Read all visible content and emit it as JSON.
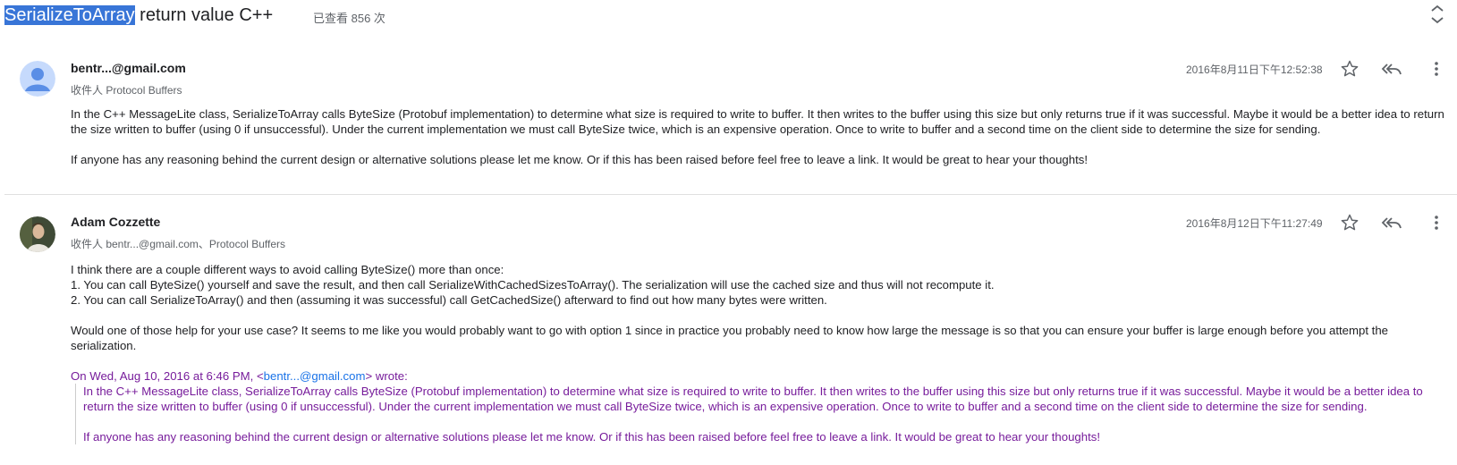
{
  "thread": {
    "subject_highlight": "SerializeToArray",
    "subject_rest": " return value C++",
    "views": "已查看 856 次"
  },
  "posts": [
    {
      "sender": "bentr...@gmail.com",
      "recipients": "收件人 Protocol Buffers",
      "date": "2016年8月11日下午12:52:38",
      "paragraphs": [
        "In the C++ MessageLite class, SerializeToArray calls ByteSize (Protobuf implementation) to determine what size is required to write to buffer. It then writes to the buffer using this size but only returns true if it was successful. Maybe it would be a better idea to return the size written to buffer (using 0 if unsuccessful). Under the current implementation we must call ByteSize twice, which is an expensive operation. Once to write to buffer and a second time on the client side to determine the size for sending.",
        "If anyone has any reasoning behind the current design or alternative solutions please let me know. Or if this has been raised before feel free to leave a link. It would be great to hear your thoughts!"
      ]
    },
    {
      "sender": "Adam Cozzette",
      "recipients": "收件人 bentr...@gmail.com、Protocol Buffers",
      "date": "2016年8月12日下午11:27:49",
      "lines": [
        "I think there are a couple different ways to avoid calling ByteSize() more than once:",
        "1. You can call ByteSize() yourself and save the result, and then call SerializeWithCachedSizesToArray(). The serialization will use the cached size and thus will not recompute it.",
        "2. You can call SerializeToArray() and then (assuming it was successful) call GetCachedSize() afterward to find out how many bytes were written."
      ],
      "paragraph2": "Would one of those help for your use case? It seems to me like you would probably want to go with option 1 since in practice you probably need to know how large the message is so that you can ensure your buffer is large enough before you attempt the serialization.",
      "quote_intro": "On Wed, Aug 10, 2016 at 6:46 PM, <",
      "quote_link": "bentr...@gmail.com",
      "quote_outro": "> wrote:",
      "quote_paragraphs": [
        "In the C++ MessageLite class, SerializeToArray calls ByteSize (Protobuf implementation) to determine what size is required to write to buffer. It then writes to the buffer using this size but only returns true if it was successful. Maybe it would be a better idea to return the size written to buffer (using 0 if unsuccessful). Under the current implementation we must call ByteSize twice, which is an expensive operation. Once to write to buffer and a second time on the client side to determine the size for sending.",
        "If anyone has any reasoning behind the current design or alternative solutions please let me know. Or if this has been raised before feel free to leave a link. It would be great to hear your thoughts!"
      ]
    }
  ],
  "icons": {
    "collapse": "collapse-chevrons-icon",
    "star": "star-icon",
    "reply_all": "reply-all-icon",
    "more": "more-vert-icon",
    "avatar_default": "default-person-avatar-icon"
  },
  "colors": {
    "selection": "#3875d7",
    "quote_text": "#771c9b",
    "link": "#1a73e8",
    "avatar_blue": "#5a8ee6"
  }
}
